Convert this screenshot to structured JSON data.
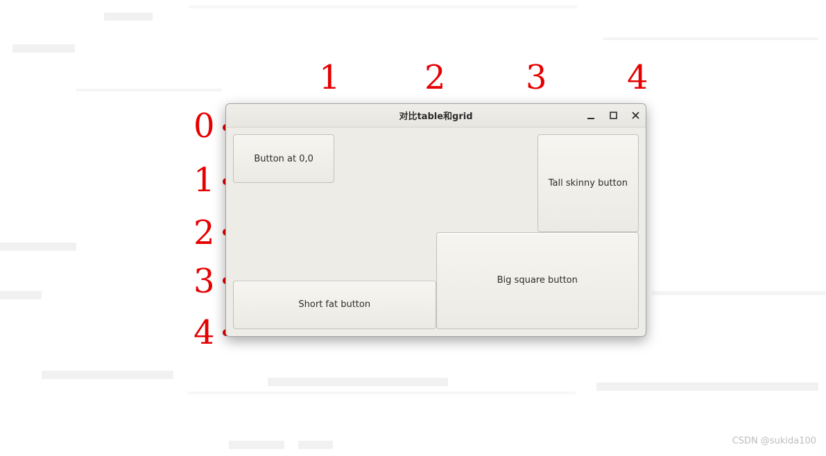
{
  "window": {
    "title": "对比table和grid",
    "controls": {
      "minimize": "–",
      "maximize": "□",
      "close": "×"
    }
  },
  "buttons": {
    "b00": "Button at 0,0",
    "tall": "Tall skinny button",
    "big": "Big square button",
    "fat": "Short fat button"
  },
  "grid_labels": {
    "cols": [
      "1",
      "2",
      "3",
      "4"
    ],
    "rows": [
      "0",
      "1",
      "2",
      "3",
      "4"
    ]
  },
  "watermark": "CSDN @sukida100"
}
